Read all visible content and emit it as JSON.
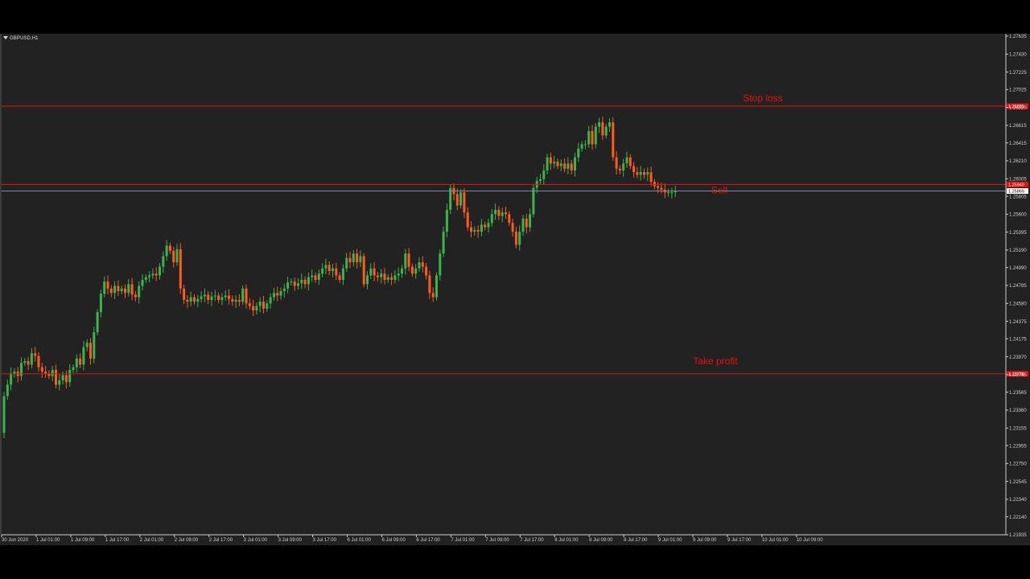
{
  "window": {
    "symbol": "GBPUSD,H1"
  },
  "colors": {
    "background": "#222222",
    "axis": "#cfcfcf",
    "bull": "#3cb44b",
    "bear": "#ff5a1f",
    "level": "#e4130f",
    "bid": "#7a8aa6"
  },
  "chart_data": {
    "type": "candlestick",
    "ylim": [
      1.21935,
      1.27635
    ],
    "y_ticks": [
      "1.27635",
      "1.27430",
      "1.27225",
      "1.27025",
      "1.26820",
      "1.26615",
      "1.26415",
      "1.26210",
      "1.26005",
      "1.25805",
      "1.25600",
      "1.25395",
      "1.25190",
      "1.24990",
      "1.24785",
      "1.24580",
      "1.24375",
      "1.24175",
      "1.23970",
      "1.23765",
      "1.23565",
      "1.23360",
      "1.23155",
      "1.22955",
      "1.22750",
      "1.22545",
      "1.22340",
      "1.22140",
      "1.21935"
    ],
    "x_ticks": [
      "30 Jun 2020",
      "1 Jul 01:00",
      "1 Jul 09:00",
      "1 Jul 17:00",
      "2 Jul 01:00",
      "2 Jul 09:00",
      "2 Jul 17:00",
      "3 Jul 01:00",
      "3 Jul 09:00",
      "3 Jul 17:00",
      "6 Jul 01:00",
      "6 Jul 09:00",
      "6 Jul 17:00",
      "7 Jul 01:00",
      "7 Jul 09:00",
      "7 Jul 17:00",
      "8 Jul 01:00",
      "8 Jul 09:00",
      "8 Jul 17:00",
      "9 Jul 01:00",
      "9 Jul 09:00",
      "9 Jul 17:00",
      "10 Jul 01:00",
      "10 Jul 09:00"
    ],
    "levels": [
      {
        "label": "Stop loss",
        "price": 1.26835,
        "tag": "1.26835"
      },
      {
        "label": "Sell",
        "price": 1.2594,
        "tag": "1.25940"
      },
      {
        "label": "Take profit",
        "price": 1.23775,
        "tag": "1.23775"
      }
    ],
    "bid": {
      "price": 1.25865,
      "tag": "1.25865"
    },
    "candles_close": [
      1.231,
      1.2352,
      1.2365,
      1.2378,
      1.238,
      1.2375,
      1.239,
      1.2392,
      1.2388,
      1.2401,
      1.2398,
      1.2385,
      1.238,
      1.2378,
      1.2375,
      1.2382,
      1.2365,
      1.237,
      1.2376,
      1.2368,
      1.2382,
      1.2385,
      1.2395,
      1.2388,
      1.2408,
      1.2413,
      1.2395,
      1.2425,
      1.2448,
      1.2469,
      1.2483,
      1.2475,
      1.247,
      1.2478,
      1.2472,
      1.2475,
      1.247,
      1.248,
      1.2468,
      1.2465,
      1.2478,
      1.2485,
      1.2488,
      1.249,
      1.2492,
      1.249,
      1.25,
      1.2512,
      1.2524,
      1.2518,
      1.2505,
      1.252,
      1.2475,
      1.2462,
      1.246,
      1.2465,
      1.246,
      1.2463,
      1.2466,
      1.2468,
      1.2462,
      1.2466,
      1.2467,
      1.2462,
      1.2465,
      1.2467,
      1.2463,
      1.246,
      1.2462,
      1.246,
      1.2475,
      1.2458,
      1.2455,
      1.245,
      1.2455,
      1.246,
      1.2452,
      1.2458,
      1.2465,
      1.247,
      1.2467,
      1.2472,
      1.2475,
      1.2482,
      1.2483,
      1.2478,
      1.2481,
      1.2485,
      1.248,
      1.2488,
      1.249,
      1.2485,
      1.2492,
      1.2498,
      1.2502,
      1.2495,
      1.2498,
      1.249,
      1.2485,
      1.2498,
      1.251,
      1.2505,
      1.2515,
      1.2505,
      1.2512,
      1.248,
      1.249,
      1.2498,
      1.249,
      1.2488,
      1.2492,
      1.2485,
      1.2488,
      1.2485,
      1.249,
      1.2492,
      1.2498,
      1.2515,
      1.25,
      1.2492,
      1.2498,
      1.2505,
      1.25,
      1.249,
      1.247,
      1.2465,
      1.249,
      1.2515,
      1.254,
      1.2565,
      1.259,
      1.2583,
      1.257,
      1.2585,
      1.2562,
      1.2545,
      1.254,
      1.2542,
      1.254,
      1.2548,
      1.2545,
      1.255,
      1.256,
      1.2565,
      1.2558,
      1.2562,
      1.256,
      1.255,
      1.254,
      1.2525,
      1.254,
      1.2555,
      1.2545,
      1.256,
      1.259,
      1.2598,
      1.26,
      1.261,
      1.2625,
      1.2618,
      1.262,
      1.2615,
      1.2618,
      1.2612,
      1.2618,
      1.261,
      1.2625,
      1.2635,
      1.264,
      1.264,
      1.2655,
      1.264,
      1.266,
      1.2665,
      1.265,
      1.266,
      1.2665,
      1.2625,
      1.2612,
      1.261,
      1.2618,
      1.2625,
      1.2615,
      1.2608,
      1.2605,
      1.2608,
      1.2605,
      1.2608,
      1.2597,
      1.2592,
      1.259,
      1.2588,
      1.2585,
      1.2585,
      1.2585,
      1.2586
    ]
  }
}
